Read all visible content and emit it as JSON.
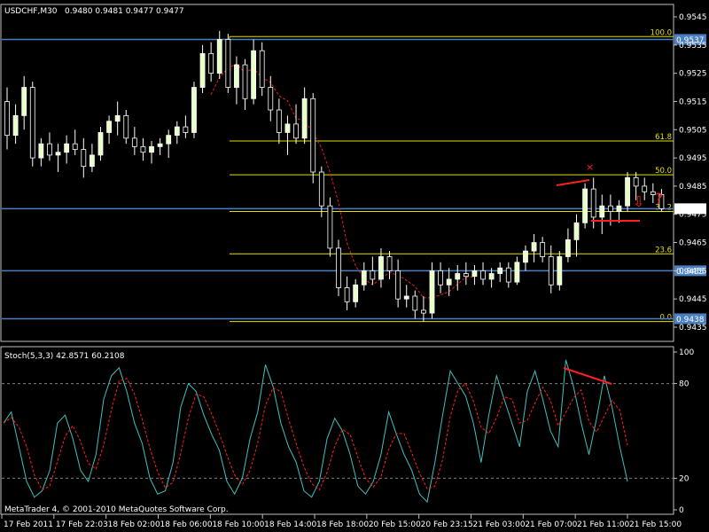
{
  "chart_data": [
    {
      "type": "candlestick",
      "header": {
        "symbol": "USDCHF,M30",
        "values": "0.9480 0.9481 0.9477 0.9477"
      },
      "price_axis": {
        "min": 0.943,
        "max": 0.955,
        "ticks": [
          "0.9545",
          "0.9535",
          "0.9525",
          "0.9515",
          "0.9505",
          "0.9495",
          "0.9485",
          "0.9475",
          "0.9465",
          "0.9455",
          "0.9445",
          "0.9435"
        ]
      },
      "current_price": "0.9477",
      "horizontal_lines": [
        {
          "label": "0.9537",
          "value": 0.9537,
          "color": "#4a7fc1"
        },
        {
          "label": "0.9477",
          "value": 0.9477,
          "color": "#4a7fc1"
        },
        {
          "label": "0.9455",
          "value": 0.9455,
          "color": "#4a7fc1"
        },
        {
          "label": "0.9438",
          "value": 0.9438,
          "color": "#4a7fc1"
        }
      ],
      "fibonacci": {
        "color": "#e0e000",
        "levels": [
          {
            "label": "100.0",
            "value": 0.9538
          },
          {
            "label": "61.8",
            "value": 0.9501
          },
          {
            "label": "50.0",
            "value": 0.9489
          },
          {
            "label": "38.2",
            "value": 0.9476
          },
          {
            "label": "23.6",
            "value": 0.9461
          },
          {
            "label": "0.0",
            "value": 0.9437
          }
        ]
      },
      "time_labels": [
        "17 Feb 2011",
        "17 Feb 22:03",
        "18 Feb 02:00",
        "18 Feb 06:00",
        "18 Feb 10:00",
        "18 Feb 14:00",
        "18 Feb 18:00",
        "20 Feb 15:00",
        "20 Feb 23:15",
        "21 Feb 03:00",
        "21 Feb 07:00",
        "21 Feb 11:00",
        "21 Feb 15:00"
      ],
      "candles": [
        [
          0.9515,
          0.952,
          0.9498,
          0.9503
        ],
        [
          0.9503,
          0.9514,
          0.95,
          0.951
        ],
        [
          0.951,
          0.9524,
          0.9505,
          0.952
        ],
        [
          0.952,
          0.9522,
          0.9492,
          0.9495
        ],
        [
          0.9495,
          0.9502,
          0.9492,
          0.95
        ],
        [
          0.95,
          0.9504,
          0.9494,
          0.9496
        ],
        [
          0.9496,
          0.95,
          0.949,
          0.9497
        ],
        [
          0.9497,
          0.9503,
          0.9493,
          0.95
        ],
        [
          0.95,
          0.9505,
          0.9496,
          0.9498
        ],
        [
          0.9498,
          0.9502,
          0.9488,
          0.9492
        ],
        [
          0.9492,
          0.95,
          0.949,
          0.9496
        ],
        [
          0.9496,
          0.9506,
          0.9494,
          0.9504
        ],
        [
          0.9504,
          0.951,
          0.95,
          0.9508
        ],
        [
          0.9508,
          0.9515,
          0.9503,
          0.951
        ],
        [
          0.951,
          0.9512,
          0.95,
          0.9502
        ],
        [
          0.9502,
          0.9506,
          0.9496,
          0.9499
        ],
        [
          0.9499,
          0.9502,
          0.9494,
          0.9497
        ],
        [
          0.9497,
          0.9501,
          0.9493,
          0.9499
        ],
        [
          0.9499,
          0.9502,
          0.9496,
          0.95
        ],
        [
          0.95,
          0.9505,
          0.9495,
          0.9503
        ],
        [
          0.9503,
          0.9508,
          0.95,
          0.9506
        ],
        [
          0.9506,
          0.951,
          0.9502,
          0.9504
        ],
        [
          0.9504,
          0.9522,
          0.9502,
          0.952
        ],
        [
          0.952,
          0.9535,
          0.9518,
          0.9532
        ],
        [
          0.9532,
          0.9536,
          0.9522,
          0.9525
        ],
        [
          0.9525,
          0.954,
          0.9523,
          0.9537
        ],
        [
          0.9537,
          0.9539,
          0.9518,
          0.952
        ],
        [
          0.952,
          0.9531,
          0.9514,
          0.9528
        ],
        [
          0.9528,
          0.953,
          0.9512,
          0.9516
        ],
        [
          0.9516,
          0.9537,
          0.9514,
          0.9533
        ],
        [
          0.9533,
          0.9536,
          0.9517,
          0.952
        ],
        [
          0.952,
          0.9524,
          0.9508,
          0.9512
        ],
        [
          0.9512,
          0.9516,
          0.95,
          0.9504
        ],
        [
          0.9504,
          0.951,
          0.9496,
          0.9507
        ],
        [
          0.9507,
          0.9514,
          0.95,
          0.9502
        ],
        [
          0.9502,
          0.952,
          0.95,
          0.9516
        ],
        [
          0.9516,
          0.9518,
          0.9486,
          0.949
        ],
        [
          0.949,
          0.9492,
          0.9474,
          0.9478
        ],
        [
          0.9478,
          0.9481,
          0.946,
          0.9463
        ],
        [
          0.9463,
          0.9466,
          0.9446,
          0.9449
        ],
        [
          0.9449,
          0.9453,
          0.9441,
          0.9444
        ],
        [
          0.9444,
          0.9452,
          0.9442,
          0.945
        ],
        [
          0.945,
          0.9458,
          0.9448,
          0.9455
        ],
        [
          0.9455,
          0.946,
          0.945,
          0.9452
        ],
        [
          0.9452,
          0.9463,
          0.9449,
          0.946
        ],
        [
          0.946,
          0.9462,
          0.9452,
          0.9455
        ],
        [
          0.9455,
          0.9459,
          0.9442,
          0.9445
        ],
        [
          0.9445,
          0.945,
          0.9442,
          0.9446
        ],
        [
          0.9446,
          0.9448,
          0.9438,
          0.9441
        ],
        [
          0.9441,
          0.9446,
          0.9437,
          0.944
        ],
        [
          0.944,
          0.9458,
          0.9438,
          0.9455
        ],
        [
          0.9455,
          0.9458,
          0.9447,
          0.945
        ],
        [
          0.945,
          0.9456,
          0.9446,
          0.9452
        ],
        [
          0.9452,
          0.9457,
          0.9448,
          0.9454
        ],
        [
          0.9454,
          0.9458,
          0.945,
          0.9453
        ],
        [
          0.9453,
          0.9457,
          0.945,
          0.9455
        ],
        [
          0.9455,
          0.9458,
          0.945,
          0.9452
        ],
        [
          0.9452,
          0.9456,
          0.9449,
          0.9454
        ],
        [
          0.9454,
          0.9458,
          0.9451,
          0.9456
        ],
        [
          0.9456,
          0.9458,
          0.9449,
          0.9451
        ],
        [
          0.9451,
          0.946,
          0.945,
          0.9458
        ],
        [
          0.9458,
          0.9464,
          0.9455,
          0.9462
        ],
        [
          0.9462,
          0.9468,
          0.9458,
          0.9465
        ],
        [
          0.9465,
          0.9467,
          0.9458,
          0.946
        ],
        [
          0.946,
          0.9464,
          0.9447,
          0.945
        ],
        [
          0.945,
          0.9462,
          0.9448,
          0.946
        ],
        [
          0.946,
          0.947,
          0.9458,
          0.9466
        ],
        [
          0.9466,
          0.9475,
          0.946,
          0.9472
        ],
        [
          0.9472,
          0.9486,
          0.947,
          0.9484
        ],
        [
          0.9484,
          0.9488,
          0.947,
          0.9474
        ],
        [
          0.9474,
          0.9482,
          0.9468,
          0.9478
        ],
        [
          0.9478,
          0.9482,
          0.9471,
          0.9476
        ],
        [
          0.9476,
          0.948,
          0.9472,
          0.9478
        ],
        [
          0.9478,
          0.949,
          0.9476,
          0.9488
        ],
        [
          0.9488,
          0.949,
          0.948,
          0.9485
        ],
        [
          0.9485,
          0.9488,
          0.948,
          0.9483
        ],
        [
          0.9483,
          0.9486,
          0.9479,
          0.9482
        ],
        [
          0.9482,
          0.9484,
          0.9476,
          0.9477
        ]
      ],
      "annotations": {
        "x_mark": "×",
        "question": "?",
        "arrow": "⇩"
      }
    },
    {
      "type": "line",
      "title": "Stoch(5,3,3) 42.8571 60.2108",
      "ylim": [
        0,
        100
      ],
      "ticks": [
        "100",
        "80",
        "20",
        "0"
      ],
      "levels": [
        80,
        20
      ],
      "main_color": "#40c0c0",
      "signal_color": "#ff2020",
      "main": [
        55,
        62,
        40,
        18,
        8,
        12,
        25,
        55,
        60,
        45,
        25,
        18,
        35,
        70,
        85,
        90,
        75,
        55,
        42,
        20,
        10,
        12,
        30,
        65,
        80,
        75,
        60,
        48,
        38,
        18,
        10,
        20,
        45,
        62,
        92,
        78,
        55,
        40,
        30,
        12,
        8,
        18,
        45,
        58,
        50,
        35,
        15,
        10,
        18,
        35,
        62,
        48,
        35,
        25,
        10,
        5,
        30,
        60,
        88,
        80,
        72,
        55,
        30,
        60,
        85,
        70,
        55,
        40,
        75,
        88,
        70,
        50,
        40,
        95,
        78,
        55,
        35,
        58,
        85,
        65,
        40,
        18
      ]
    }
  ],
  "footer": "MetaTrader 4, © 2001-2010 MetaQuotes Software Corp.",
  "colors": {
    "bull": "#e8ffc8",
    "bear": "#000000",
    "wick": "#ffffff",
    "grid": "#808080",
    "ma": "#e02020",
    "trend": "#ff2020"
  }
}
